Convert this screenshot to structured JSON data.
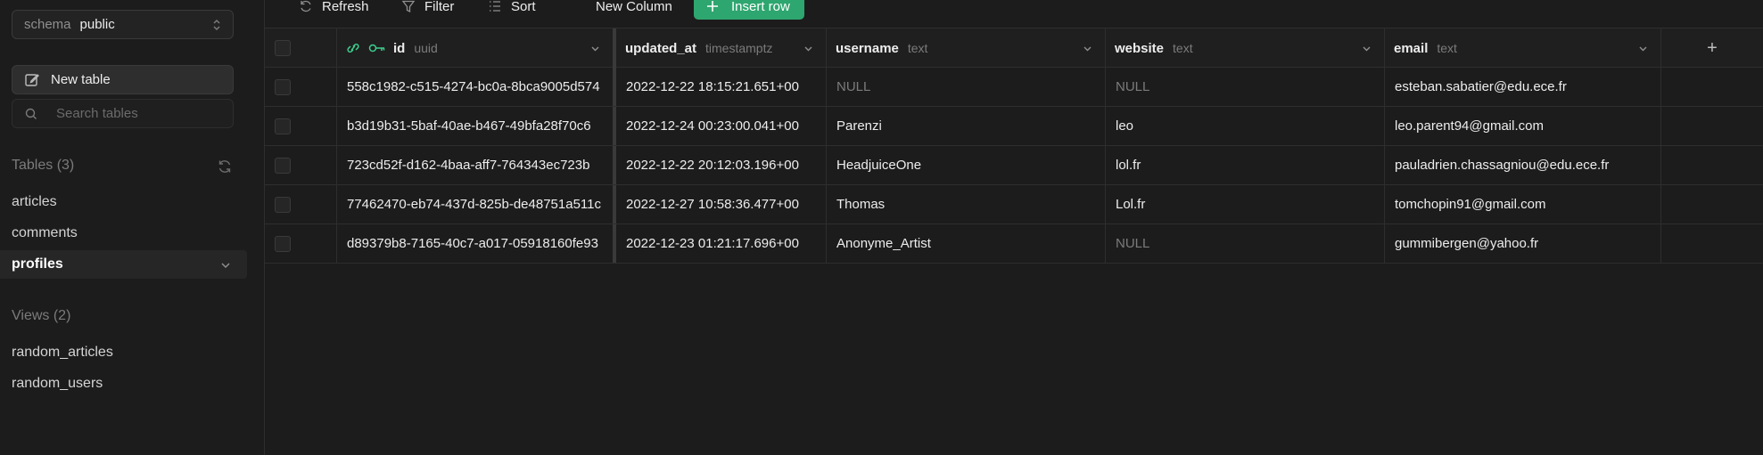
{
  "sidebar": {
    "schema_label": "schema",
    "schema_value": "public",
    "new_table_label": "New table",
    "search_placeholder": "Search tables",
    "tables_heading": "Tables (3)",
    "tables": [
      "articles",
      "comments",
      "profiles"
    ],
    "active_table": "profiles",
    "views_heading": "Views (2)",
    "views": [
      "random_articles",
      "random_users"
    ]
  },
  "toolbar": {
    "refresh_label": "Refresh",
    "filter_label": "Filter",
    "sort_label": "Sort",
    "new_column_label": "New Column",
    "insert_row_label": "Insert row"
  },
  "grid": {
    "columns": [
      {
        "name": "id",
        "type": "uuid"
      },
      {
        "name": "updated_at",
        "type": "timestamptz"
      },
      {
        "name": "username",
        "type": "text"
      },
      {
        "name": "website",
        "type": "text"
      },
      {
        "name": "email",
        "type": "text"
      }
    ],
    "add_column_symbol": "+",
    "rows": [
      [
        "558c1982-c515-4274-bc0a-8bca9005d574",
        "2022-12-22 18:15:21.651+00",
        "NULL",
        "NULL",
        "esteban.sabatier@edu.ece.fr"
      ],
      [
        "b3d19b31-5baf-40ae-b467-49bfa28f70c6",
        "2022-12-24 00:23:00.041+00",
        "Parenzi",
        "leo",
        "leo.parent94@gmail.com"
      ],
      [
        "723cd52f-d162-4baa-aff7-764343ec723b",
        "2022-12-22 20:12:03.196+00",
        "HeadjuiceOne",
        "lol.fr",
        "pauladrien.chassagniou@edu.ece.fr"
      ],
      [
        "77462470-eb74-437d-825b-de48751a511c",
        "2022-12-27 10:58:36.477+00",
        "Thomas",
        "Lol.fr",
        "tomchopin91@gmail.com"
      ],
      [
        "d89379b8-7165-40c7-a017-05918160fe93",
        "2022-12-23 01:21:17.696+00",
        "Anonyme_Artist",
        "NULL",
        "gummibergen@yahoo.fr"
      ]
    ]
  },
  "colors": {
    "accent": "#2ea66f",
    "background": "#1c1c1c",
    "key_icon": "#3ecf8e"
  }
}
